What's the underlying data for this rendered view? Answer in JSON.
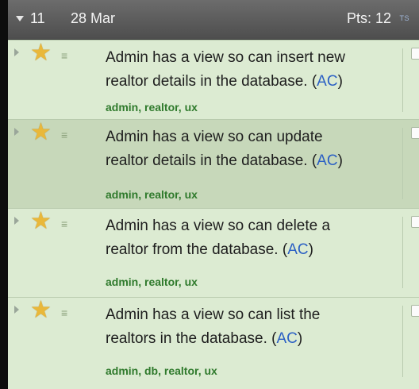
{
  "iteration": {
    "number": "11",
    "date": "28 Mar",
    "points": "Pts: 12",
    "ts_label": "TS"
  },
  "stories": [
    {
      "line1": "Admin has a view so can insert new",
      "line2": "realtor details in the database.",
      "ac": "AC",
      "paren_open": "(",
      "paren_close": ")",
      "tags": "admin, realtor, ux",
      "selected": false
    },
    {
      "line1": "Admin has a view so can update",
      "line2": "realtor details in the database.",
      "ac": "AC",
      "paren_open": "(",
      "paren_close": ")",
      "tags": "admin, realtor, ux",
      "selected": true
    },
    {
      "line1": "Admin has a view so can delete a",
      "line2": "realtor from the database.",
      "ac": "AC",
      "paren_open": "(",
      "paren_close": ")",
      "tags": "admin, realtor, ux",
      "selected": false
    },
    {
      "line1": "Admin has a view so can list the",
      "line2": "realtors in the database.",
      "ac": "AC",
      "paren_open": "(",
      "paren_close": ")",
      "tags": "admin, db, realtor, ux",
      "selected": false
    }
  ],
  "icons": {
    "expand": "triangle-down-icon",
    "row_expand": "triangle-right-icon",
    "star": "star-icon",
    "grip": "drag-handle-icon",
    "checkbox": "checkbox"
  },
  "colors": {
    "header": "#5a5a5a",
    "row_bg": "#dcebd2",
    "row_selected": "#c7d8ba",
    "tag_text": "#2f7a2c",
    "ac_link": "#2a5fc4",
    "star": "#e9b83a"
  }
}
